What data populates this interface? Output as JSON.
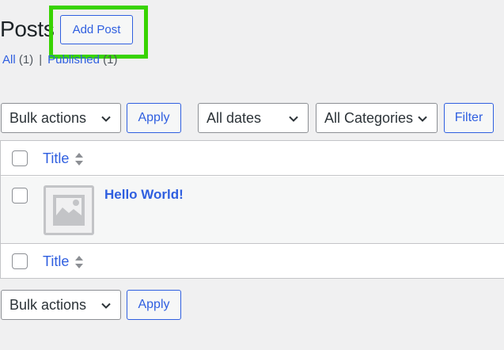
{
  "page": {
    "title": "Posts",
    "add_button_label": "Add Post"
  },
  "filters_links": {
    "all_label": "All",
    "all_count": "(1)",
    "separator": "|",
    "published_label": "Published",
    "published_count": "(1)"
  },
  "toolbar_top": {
    "bulk_actions_selected": "Bulk actions",
    "apply_label": "Apply",
    "dates_selected": "All dates",
    "categories_selected": "All Categories",
    "filter_label": "Filter"
  },
  "table": {
    "column_title": "Title",
    "rows": [
      {
        "title": "Hello World!",
        "thumbnail_icon": "image-placeholder-icon"
      }
    ]
  },
  "toolbar_bottom": {
    "bulk_actions_selected": "Bulk actions",
    "apply_label": "Apply"
  },
  "colors": {
    "accent": "#2f5fe0",
    "highlight": "#38d300",
    "background": "#f0f0f1"
  }
}
